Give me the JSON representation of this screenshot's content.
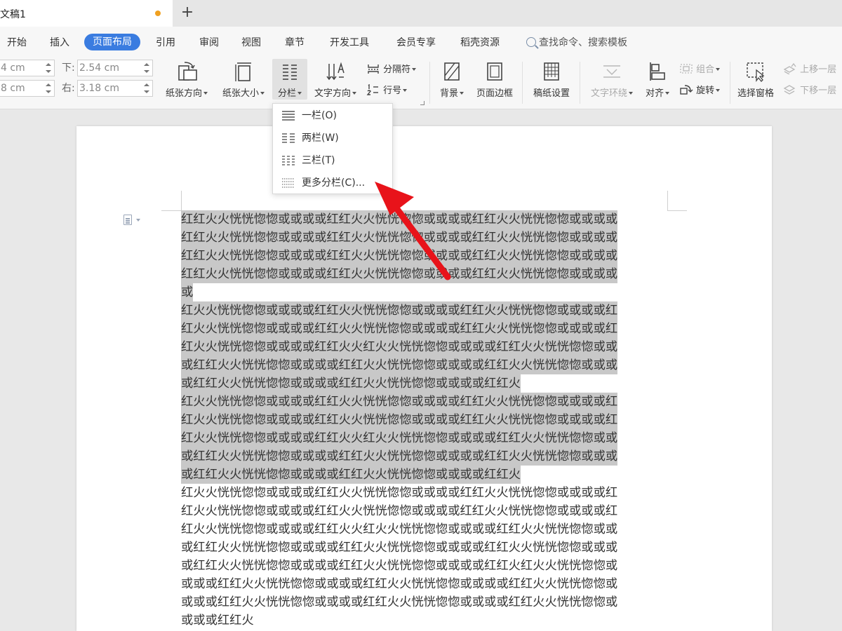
{
  "tab": {
    "title": "文稿1",
    "new_tab": "+"
  },
  "menu": {
    "items": [
      "开始",
      "插入",
      "页面布局",
      "引用",
      "审阅",
      "视图",
      "章节",
      "开发工具",
      "会员专享",
      "稻壳资源"
    ],
    "active": "页面布局",
    "search": "查找命令、搜索模板"
  },
  "margins": {
    "top_value": "4 cm",
    "bottom_label": "下:",
    "bottom_value": "2.54 cm",
    "left_value": "8 cm",
    "right_label": "右:",
    "right_value": "3.18 cm"
  },
  "toolbar": {
    "orientation": "纸张方向",
    "size": "纸张大小",
    "columns": "分栏",
    "text_direction": "文字方向",
    "separator": "分隔符",
    "line_number": "行号",
    "background": "背景",
    "page_border": "页面边框",
    "manuscript": "稿纸设置",
    "text_wrap": "文字环绕",
    "align": "对齐",
    "group": "组合",
    "rotate": "旋转",
    "selection_pane": "选择窗格",
    "bring_forward": "上移一层",
    "send_backward": "下移一层"
  },
  "columns_menu": {
    "one": "一栏(O)",
    "two": "两栏(W)",
    "three": "三栏(T)",
    "more": "更多分栏(C)..."
  },
  "document": {
    "lines": [
      "红红火火恍恍惚惚或或或或红红火火恍恍惚惚或或或或红红火火恍恍惚惚或或或或",
      "红红火火恍恍惚惚或或或或红红火火恍恍惚惚或或或或红红火火恍恍惚惚或或或或",
      "红红火火恍恍惚惚或或或或红红火火恍恍惚惚或或或或红红火火恍恍惚惚或或或或",
      "红红火火恍恍惚惚或或或或红红火火恍恍惚惚或或或或红红火火恍恍惚惚或或或或",
      "或",
      "红火火恍恍惚惚或或或或红红火火恍恍惚惚或或或或红红火火恍恍惚惚或或或或红",
      "红火火恍恍惚惚或或或或红红火火恍恍惚惚或或或或红红火火恍恍惚惚或或或或红",
      "红火火恍恍惚惚或或或或红红火火红火火恍恍惚惚或或或或红红火火恍恍惚惚或或",
      "或红红火火恍恍惚惚或或或或红红火火恍恍惚惚或或或或红红火火恍恍惚惚或或或",
      "或红红火火恍恍惚惚或或或或红红火火恍恍惚惚或或或或红红火",
      "红火火恍恍惚惚或或或或红红火火恍恍惚惚或或或或红红火火恍恍惚惚或或或或红",
      "红火火恍恍惚惚或或或或红红火火恍恍惚惚或或或或红红火火恍恍惚惚或或或或红",
      "红火火恍恍惚惚或或或或红红火火红火火恍恍惚惚或或或或红红火火恍恍惚惚或或",
      "或红红火火恍恍惚惚或或或或红红火火恍恍惚惚或或或或红红火火恍恍惚惚或或或",
      "或红红火火恍恍惚惚或或或或红红火火恍恍惚惚或或或或红红火",
      "红火火恍恍惚惚或或或或红红火火恍恍惚惚或或或或红红火火恍恍惚惚或或或或红",
      "红火火恍恍惚惚或或或或红红火火恍恍惚惚或或或或红红火火恍恍惚惚或或或或红",
      "红火火恍恍惚惚或或或或红红火火红火火恍恍惚惚或或或或红红火火恍恍惚惚或或",
      "或红红火火恍恍惚惚或或或或红红火火恍恍惚惚或或或或红红火火恍恍惚惚或或或",
      "或红红火火恍恍惚惚或或或或红红火火恍恍惚惚或或或或红红火红火火恍恍惚惚或",
      "或或或红红火火恍恍惚惚或或或或红红火火恍恍惚惚或或或或红红火火恍恍惚惚或",
      "或或或红红火火恍恍惚惚或或或或红红火火恍恍惚惚或或或或红红火火恍恍惚惚或",
      "或或或红红火"
    ],
    "selected_line_count": 15
  },
  "colors": {
    "accent": "#3a7ce0",
    "selection": "#c8c8c8",
    "arrow": "#e8131a",
    "modified_dot": "#f0a020"
  }
}
